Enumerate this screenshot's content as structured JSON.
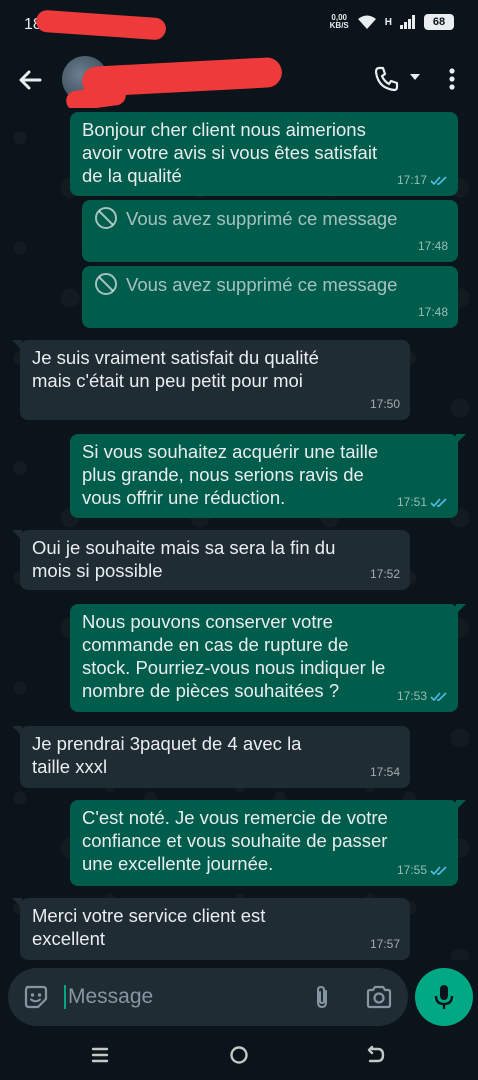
{
  "status_bar": {
    "time": "18",
    "net_speed_value": "0,00",
    "net_speed_unit": "KB/S",
    "network_type": "H",
    "battery": "68"
  },
  "header": {
    "back_icon": "arrow-left-icon",
    "call_icon": "phone-icon",
    "menu_icon": "more-vert-icon"
  },
  "messages": [
    {
      "id": "m1",
      "direction": "out",
      "text": "Bonjour cher client nous aimerions\navoir votre avis si vous êtes satisfait\nde la qualité",
      "time": "17:17",
      "status": "read"
    },
    {
      "id": "m2",
      "direction": "out",
      "deleted": true,
      "text": "Vous avez supprimé ce message",
      "time": "17:48"
    },
    {
      "id": "m3",
      "direction": "out",
      "deleted": true,
      "text": "Vous avez supprimé ce message",
      "time": "17:48"
    },
    {
      "id": "m4",
      "direction": "in",
      "text": "Je suis vraiment satisfait du qualité\nmais c'était un peu petit pour moi",
      "time": "17:50"
    },
    {
      "id": "m5",
      "direction": "out",
      "text": "Si vous souhaitez acquérir une taille\nplus grande, nous serions ravis de\nvous offrir une réduction.",
      "time": "17:51",
      "status": "read"
    },
    {
      "id": "m6",
      "direction": "in",
      "text": "Oui je souhaite mais sa sera la fin du\nmois si possible",
      "time": "17:52"
    },
    {
      "id": "m7",
      "direction": "out",
      "text": "Nous pouvons conserver votre\ncommande en cas de rupture de\nstock. Pourriez-vous nous indiquer le\nnombre de pièces souhaitées ?",
      "time": "17:53",
      "status": "read"
    },
    {
      "id": "m8",
      "direction": "in",
      "text": "Je prendrai 3paquet de 4  avec la\ntaille xxxl",
      "time": "17:54"
    },
    {
      "id": "m9",
      "direction": "out",
      "text": "C'est noté. Je vous remercie de votre\nconfiance et vous souhaite de passer\nune excellente journée.",
      "time": "17:55",
      "status": "read"
    },
    {
      "id": "m10",
      "direction": "in",
      "text": "Merci  votre service client est\nexcellent",
      "time": "17:57"
    }
  ],
  "composer": {
    "placeholder": "Message",
    "emoji_icon": "sticker-icon",
    "attach_icon": "paperclip-icon",
    "camera_icon": "camera-icon",
    "mic_icon": "microphone-icon"
  },
  "colors": {
    "background": "#0b141a",
    "outgoing_bubble": "#005c4b",
    "incoming_bubble": "#202c33",
    "accent": "#00a884",
    "read_ticks": "#53bdeb"
  }
}
